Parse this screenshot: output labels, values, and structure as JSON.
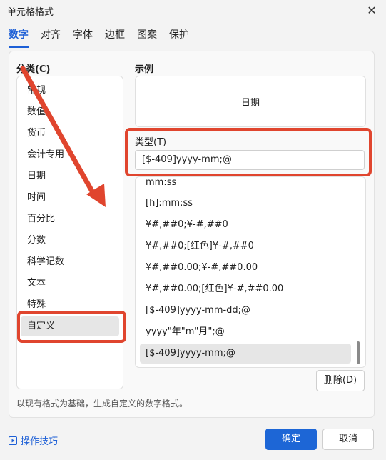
{
  "window": {
    "title": "单元格格式",
    "close_icon": "close-icon"
  },
  "tabs": [
    {
      "label": "数字",
      "active": true
    },
    {
      "label": "对齐"
    },
    {
      "label": "字体"
    },
    {
      "label": "边框"
    },
    {
      "label": "图案"
    },
    {
      "label": "保护"
    }
  ],
  "category": {
    "label": "分类(C)",
    "items": [
      "常规",
      "数值",
      "货币",
      "会计专用",
      "日期",
      "时间",
      "百分比",
      "分数",
      "科学记数",
      "文本",
      "特殊",
      "自定义"
    ],
    "selected": "自定义"
  },
  "sample": {
    "label": "示例",
    "value": "日期"
  },
  "type": {
    "label": "类型(T)",
    "value": "[$-409]yyyy-mm;@",
    "list": [
      "mm:ss",
      "[h]:mm:ss",
      "¥#,##0;¥-#,##0",
      "¥#,##0;[红色]¥-#,##0",
      "¥#,##0.00;¥-#,##0.00",
      "¥#,##0.00;[红色]¥-#,##0.00",
      "[$-409]yyyy-mm-dd;@",
      "yyyy\"年\"m\"月\";@",
      "[$-409]yyyy-mm;@"
    ],
    "selected": "[$-409]yyyy-mm;@"
  },
  "delete_button": "删除(D)",
  "description": "以现有格式为基础，生成自定义的数字格式。",
  "tips_link": "操作技巧",
  "ok_button": "确定",
  "cancel_button": "取消",
  "colors": {
    "accent": "#1d66d6",
    "annotation_red": "#e0452e"
  }
}
